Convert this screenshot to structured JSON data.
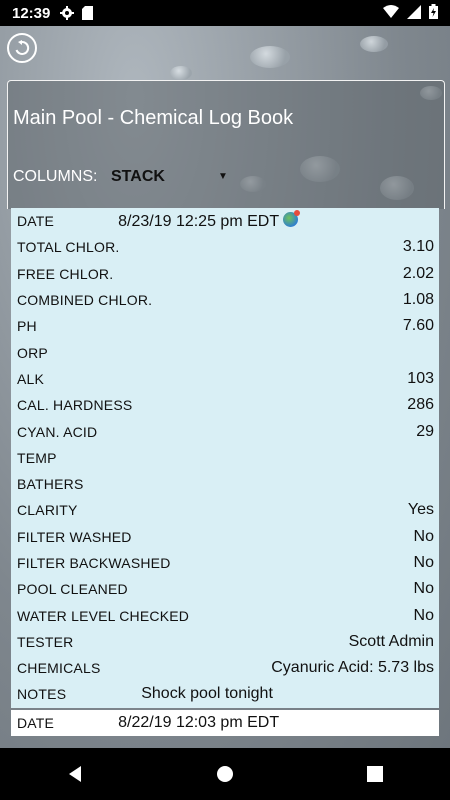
{
  "status_bar": {
    "time": "12:39"
  },
  "header": {
    "title": "Main Pool -  Chemical Log Book",
    "columns_label": "COLUMNS:",
    "columns_value": "STACK"
  },
  "entries": [
    {
      "rows": [
        {
          "label": "DATE",
          "value": "8/23/19 12:25 pm EDT"
        },
        {
          "label": "TOTAL CHLOR.",
          "value": "3.10"
        },
        {
          "label": "FREE CHLOR.",
          "value": "2.02"
        },
        {
          "label": "COMBINED CHLOR.",
          "value": "1.08"
        },
        {
          "label": "PH",
          "value": "7.60"
        },
        {
          "label": "ORP",
          "value": ""
        },
        {
          "label": "ALK",
          "value": "103"
        },
        {
          "label": "CAL. HARDNESS",
          "value": "286"
        },
        {
          "label": "CYAN. ACID",
          "value": "29"
        },
        {
          "label": "TEMP",
          "value": ""
        },
        {
          "label": "BATHERS",
          "value": ""
        },
        {
          "label": "CLARITY",
          "value": "Yes"
        },
        {
          "label": "FILTER WASHED",
          "value": "No"
        },
        {
          "label": "FILTER BACKWASHED",
          "value": "No"
        },
        {
          "label": "POOL CLEANED",
          "value": "No"
        },
        {
          "label": "WATER LEVEL CHECKED",
          "value": "No"
        },
        {
          "label": "TESTER",
          "value": "Scott Admin"
        },
        {
          "label": "CHEMICALS",
          "value": "Cyanuric Acid: 5.73 lbs"
        },
        {
          "label": "NOTES",
          "value": "Shock pool tonight"
        }
      ]
    },
    {
      "rows": [
        {
          "label": "DATE",
          "value": "8/22/19 12:03 pm EDT"
        }
      ]
    }
  ],
  "colors": {
    "entry_bg": "#d9eff5",
    "status_bar_bg": "#000000",
    "nav_bar_bg": "#000000"
  },
  "icons": [
    "settings-gear-icon",
    "sd-card-icon",
    "wifi-icon",
    "signal-icon",
    "battery-icon",
    "back-arrow-icon",
    "globe-icon",
    "nav-back-icon",
    "nav-home-icon",
    "nav-recents-icon"
  ]
}
